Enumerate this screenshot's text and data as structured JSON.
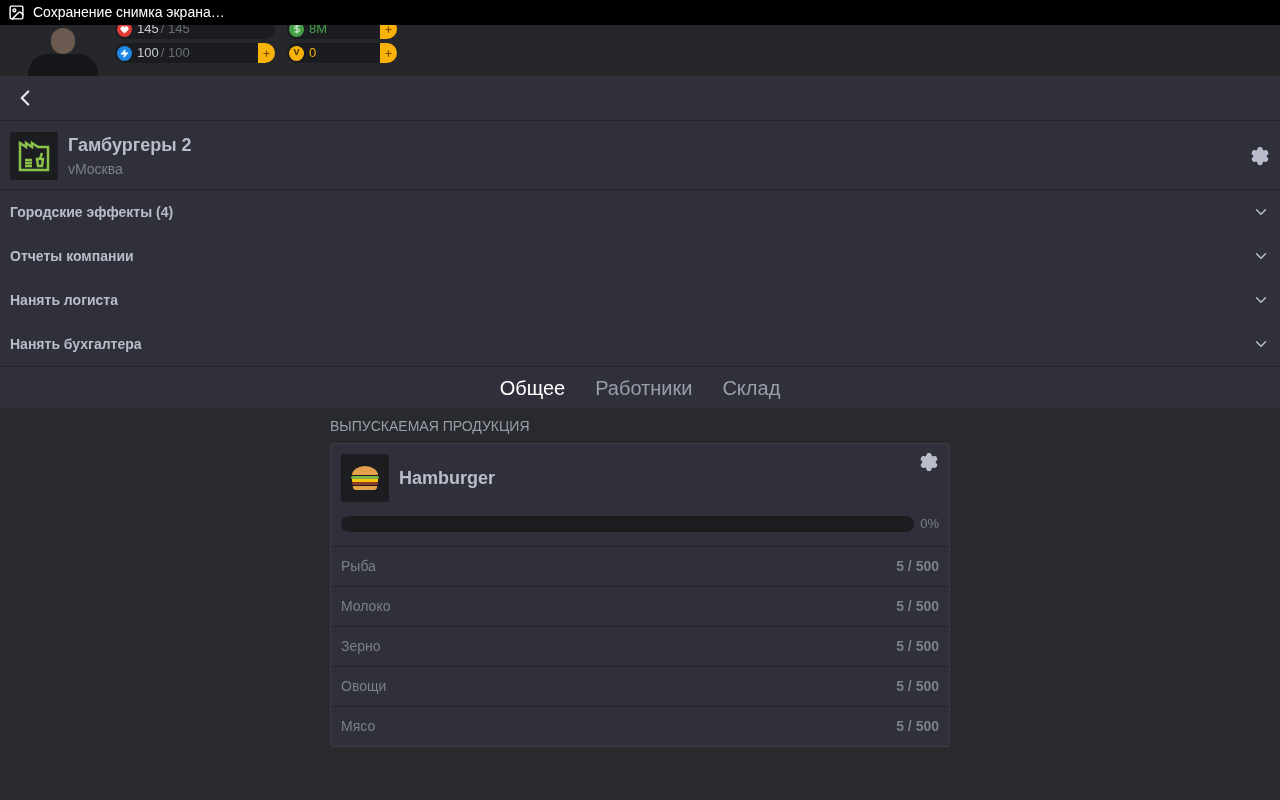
{
  "status_bar": {
    "notification": "Сохранение снимка экрана…"
  },
  "stats": [
    {
      "kind": "health",
      "value": "145",
      "max": "/ 145",
      "plus": false
    },
    {
      "kind": "money",
      "value": "8M",
      "plus": true
    },
    {
      "kind": "energy",
      "value": "100",
      "max": "/ 100",
      "plus": true
    },
    {
      "kind": "coin",
      "symbol": "V",
      "value": "0",
      "plus": true
    }
  ],
  "company": {
    "title": "Гамбургеры 2",
    "city": "vМосква"
  },
  "sections": [
    {
      "label": "Городские эффекты (4)",
      "expanded": false
    },
    {
      "label": "Отчеты компании",
      "expanded": false
    },
    {
      "label": "Нанять логиста",
      "expanded": false
    },
    {
      "label": "Нанять бухгалтера",
      "expanded": false
    }
  ],
  "tabs": [
    {
      "label": "Общее",
      "selected": true
    },
    {
      "label": "Работники",
      "selected": false
    },
    {
      "label": "Склад",
      "selected": false
    }
  ],
  "production": {
    "heading": "ВЫПУСКАЕМАЯ ПРОДУКЦИЯ",
    "product": "Hamburger",
    "level": 0,
    "percent": "0%",
    "resources": [
      {
        "name": "Рыба",
        "amount": "5 / 500"
      },
      {
        "name": "Молоко",
        "amount": "5 / 500"
      },
      {
        "name": "Зерно",
        "amount": "5 / 500"
      },
      {
        "name": "Овощи",
        "amount": "5 / 500"
      },
      {
        "name": "Мясо",
        "amount": "5 / 500"
      }
    ]
  }
}
